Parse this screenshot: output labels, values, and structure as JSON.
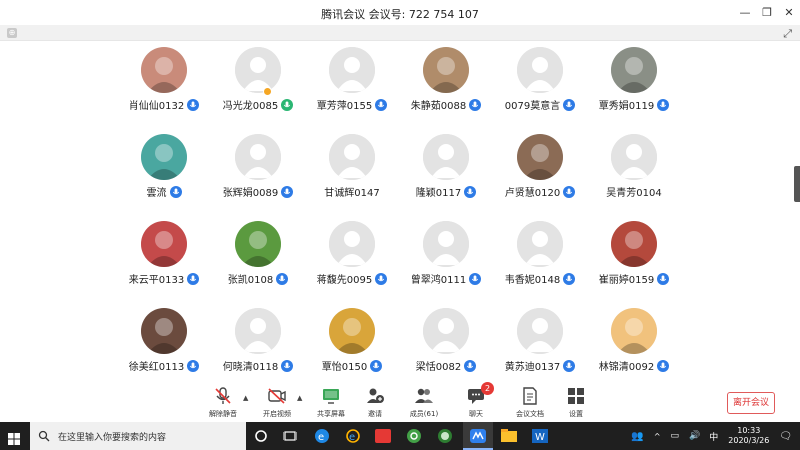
{
  "window": {
    "title": "腾讯会议  会议号: 722 754 107",
    "controls": [
      "minimize-icon",
      "restore-icon",
      "close-icon"
    ]
  },
  "participants": [
    {
      "name": "肖仙仙0132",
      "avatar": "photo",
      "color": "#c98b7a",
      "mic": "on"
    },
    {
      "name": "冯光龙0085",
      "avatar": "default",
      "mic": "speaking",
      "host": true
    },
    {
      "name": "覃芳萍0155",
      "avatar": "default",
      "mic": "on"
    },
    {
      "name": "朱静茹0088",
      "avatar": "photo",
      "color": "#b08c6a",
      "mic": "on"
    },
    {
      "name": "0079莫意言",
      "avatar": "default",
      "mic": "on"
    },
    {
      "name": "覃秀娟0119",
      "avatar": "photo",
      "color": "#8a8f86",
      "mic": "on"
    },
    {
      "name": "雲流",
      "avatar": "photo",
      "color": "#4aa7a0",
      "mic": "on"
    },
    {
      "name": "张辉娟0089",
      "avatar": "default",
      "mic": "on"
    },
    {
      "name": "甘诚辉0147",
      "avatar": "default",
      "mic": "none"
    },
    {
      "name": "隆颖0117",
      "avatar": "default",
      "mic": "on"
    },
    {
      "name": "卢贤慧0120",
      "avatar": "photo",
      "color": "#8b6b55",
      "mic": "on"
    },
    {
      "name": "吴青芳0104",
      "avatar": "default",
      "mic": "none"
    },
    {
      "name": "来云平0133",
      "avatar": "photo",
      "color": "#c44a4a",
      "mic": "on"
    },
    {
      "name": "张凯0108",
      "avatar": "photo",
      "color": "#5b9a3f",
      "mic": "on"
    },
    {
      "name": "蒋馥先0095",
      "avatar": "default",
      "mic": "on"
    },
    {
      "name": "曾翠鸿0111",
      "avatar": "default",
      "mic": "on"
    },
    {
      "name": "韦香妮0148",
      "avatar": "default",
      "mic": "on"
    },
    {
      "name": "崔丽婷0159",
      "avatar": "photo",
      "color": "#b4493c",
      "mic": "on"
    },
    {
      "name": "徐美红0113",
      "avatar": "photo",
      "color": "#6b4b3e",
      "mic": "on"
    },
    {
      "name": "何晓清0118",
      "avatar": "default",
      "mic": "on"
    },
    {
      "name": "覃怡0150",
      "avatar": "photo",
      "color": "#d9a53a",
      "mic": "on"
    },
    {
      "name": "梁恬0082",
      "avatar": "default",
      "mic": "on"
    },
    {
      "name": "黄苏迪0137",
      "avatar": "default",
      "mic": "on"
    },
    {
      "name": "林锦清0092",
      "avatar": "photo",
      "color": "#f1c27d",
      "mic": "on"
    }
  ],
  "toolbar": {
    "unmute": "解除静音",
    "video": "开启视频",
    "share": "共享屏幕",
    "invite": "邀请",
    "members": "成员(61)",
    "chat": "聊天",
    "chat_badge": "2",
    "docs": "会议文档",
    "settings": "设置",
    "leave": "离开会议"
  },
  "taskbar": {
    "search_placeholder": "在这里输入你要搜索的内容",
    "time": "10:33",
    "date": "2020/3/26"
  }
}
